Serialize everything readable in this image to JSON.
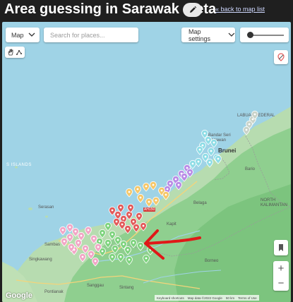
{
  "header": {
    "title": "Area guessing in Sarawak meta",
    "back_link": "« back to map list"
  },
  "controls": {
    "map_type": "Map",
    "search_placeholder": "Search for places...",
    "map_settings": "Map settings"
  },
  "map_labels": {
    "labuan": "LABUAN FEDERAL",
    "bandar": "Bandar Seri Begawan",
    "brunei": "Brunei",
    "islands": "S ISLANDS",
    "bario": "Bario",
    "serasan": "Serasan",
    "north_kal": "NORTH KALIMANTAN",
    "belaga": "Belaga",
    "kapit": "Kapit",
    "sambas": "Sambas",
    "singkawang": "Singkawang",
    "borneo": "Borneo",
    "sanggau": "Sanggau",
    "sintang": "Sintang",
    "pontianak": "Pontianak",
    "highway": "AH150"
  },
  "footer": {
    "google": "Google",
    "shortcuts": "Keyboard shortcuts",
    "map_data": "Map data ©2022 Google",
    "scale": "50 km",
    "terms": "Terms of Use"
  },
  "colors": {
    "pink": "#f2a6c6",
    "red": "#e25a5a",
    "green": "#7ed37e",
    "yellow": "#f5c76a",
    "purple": "#b98be6",
    "cyan": "#8fdde6",
    "gray": "#c9d3c9",
    "arrow": "#e01818"
  },
  "icons": {
    "edit": "pencil-icon",
    "hand": "hand-icon",
    "line": "draw-line-icon",
    "layers": "layers-icon",
    "pegman": "pegman-icon"
  }
}
